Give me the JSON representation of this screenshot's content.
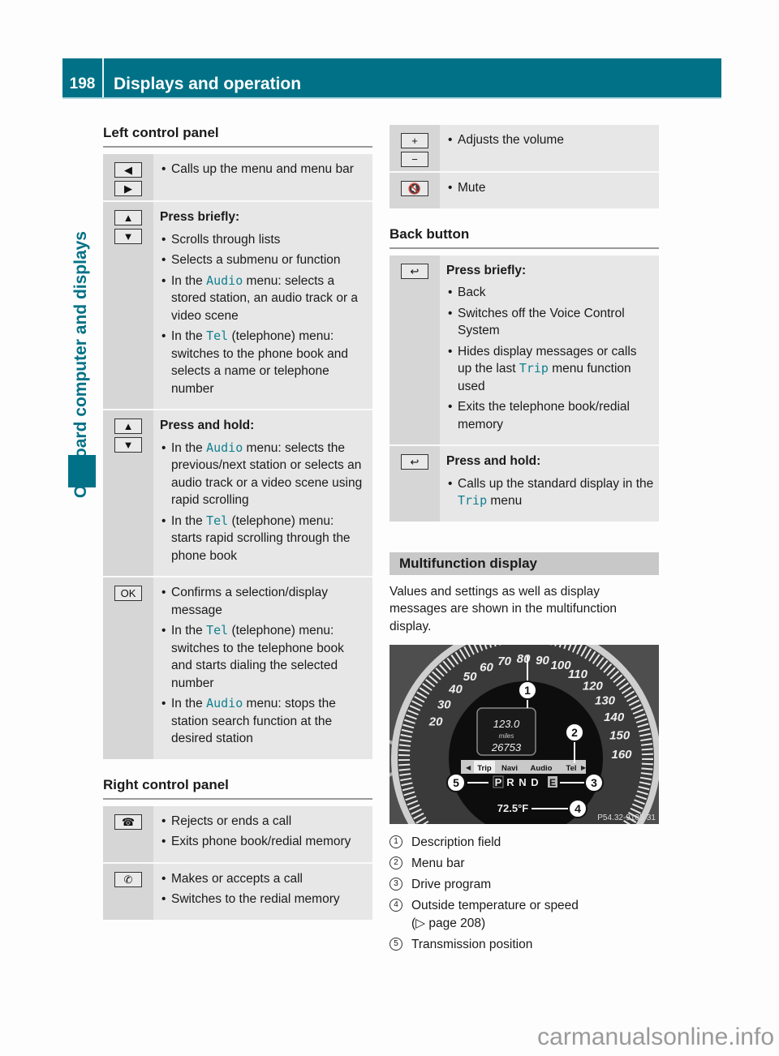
{
  "header": {
    "page_number": "198",
    "title": "Displays and operation"
  },
  "side_tab": {
    "label": "On-board computer and displays"
  },
  "left_column": {
    "left_panel": {
      "title": "Left control panel",
      "rows": [
        {
          "keys": [
            "◀",
            "▶"
          ],
          "key_names": [
            "left-arrow-icon",
            "right-arrow-icon"
          ],
          "heading": "",
          "bullets": [
            {
              "pre": "Calls up the menu and menu bar",
              "hl": "",
              "post": ""
            }
          ]
        },
        {
          "keys": [
            "▲",
            "▼"
          ],
          "key_names": [
            "up-arrow-icon",
            "down-arrow-icon"
          ],
          "heading": "Press briefly:",
          "bullets": [
            {
              "pre": "Scrolls through lists",
              "hl": "",
              "post": ""
            },
            {
              "pre": "Selects a submenu or function",
              "hl": "",
              "post": ""
            },
            {
              "pre": "In the ",
              "hl": "Audio",
              "post": " menu: selects a stored station, an audio track or a video scene"
            },
            {
              "pre": "In the ",
              "hl": "Tel",
              "post": " (telephone) menu: switches to the phone book and selects a name or telephone number"
            }
          ]
        },
        {
          "keys": [
            "▲",
            "▼"
          ],
          "key_names": [
            "up-arrow-icon",
            "down-arrow-icon"
          ],
          "heading": "Press and hold:",
          "bullets": [
            {
              "pre": "In the ",
              "hl": "Audio",
              "post": " menu: selects the previous/next station or selects an audio track or a video scene using rapid scrolling"
            },
            {
              "pre": "In the ",
              "hl": "Tel",
              "post": " (telephone) menu: starts rapid scrolling through the phone book"
            }
          ]
        },
        {
          "keys": [
            "OK"
          ],
          "key_names": [
            "ok-button-icon"
          ],
          "heading": "",
          "bullets": [
            {
              "pre": "Confirms a selection/display message",
              "hl": "",
              "post": ""
            },
            {
              "pre": "In the ",
              "hl": "Tel",
              "post": " (telephone) menu: switches to the telephone book and starts dialing the selected number"
            },
            {
              "pre": "In the ",
              "hl": "Audio",
              "post": " menu: stops the station search function at the desired station"
            }
          ]
        }
      ]
    },
    "right_panel": {
      "title": "Right control panel",
      "rows": [
        {
          "keys": [
            "☎"
          ],
          "key_names": [
            "end-call-icon"
          ],
          "heading": "",
          "bullets": [
            {
              "pre": "Rejects or ends a call",
              "hl": "",
              "post": ""
            },
            {
              "pre": "Exits phone book/redial memory",
              "hl": "",
              "post": ""
            }
          ]
        },
        {
          "keys": [
            "✆"
          ],
          "key_names": [
            "accept-call-icon"
          ],
          "heading": "",
          "bullets": [
            {
              "pre": "Makes or accepts a call",
              "hl": "",
              "post": ""
            },
            {
              "pre": "Switches to the redial memory",
              "hl": "",
              "post": ""
            }
          ]
        }
      ]
    }
  },
  "right_column": {
    "volume_rows": [
      {
        "keys": [
          "+",
          "−"
        ],
        "key_names": [
          "volume-up-icon",
          "volume-down-icon"
        ],
        "heading": "",
        "bullets": [
          {
            "pre": "Adjusts the volume",
            "hl": "",
            "post": ""
          }
        ]
      },
      {
        "keys": [
          "🔇"
        ],
        "key_names": [
          "mute-icon"
        ],
        "heading": "",
        "bullets": [
          {
            "pre": "Mute",
            "hl": "",
            "post": ""
          }
        ]
      }
    ],
    "back_button": {
      "title": "Back button",
      "rows": [
        {
          "keys": [
            "↩"
          ],
          "key_names": [
            "back-icon"
          ],
          "heading": "Press briefly:",
          "bullets": [
            {
              "pre": "Back",
              "hl": "",
              "post": ""
            },
            {
              "pre": "Switches off the Voice Control System",
              "hl": "",
              "post": ""
            },
            {
              "pre": "Hides display messages or calls up the last ",
              "hl": "Trip",
              "post": " menu function used"
            },
            {
              "pre": "Exits the telephone book/redial memory",
              "hl": "",
              "post": ""
            }
          ]
        },
        {
          "keys": [
            "↩"
          ],
          "key_names": [
            "back-icon"
          ],
          "heading": "Press and hold:",
          "bullets": [
            {
              "pre": "Calls up the standard display in the ",
              "hl": "Trip",
              "post": " menu"
            }
          ]
        }
      ]
    },
    "multifunction": {
      "title": "Multifunction display",
      "intro": "Values and settings as well as display messages are shown in the multifunction display.",
      "gauge": {
        "speed_labels": [
          "20",
          "30",
          "40",
          "50",
          "60",
          "70",
          "80",
          "90",
          "100",
          "110",
          "120",
          "130",
          "140",
          "150",
          "160"
        ],
        "trip_value": "123.0",
        "trip_unit": "miles",
        "odometer": "26753",
        "menu_items": [
          "Trip",
          "Navi",
          "Audio",
          "Tel"
        ],
        "active_menu": "Trip",
        "gears": [
          "P",
          "R",
          "N",
          "D"
        ],
        "active_gear": "P",
        "drive_program": "E",
        "temperature": "72.5°F",
        "callouts": [
          "1",
          "2",
          "3",
          "4",
          "5"
        ],
        "image_code": "P54.32-9105-31"
      },
      "legend": [
        {
          "num": "1",
          "text": "Description field"
        },
        {
          "num": "2",
          "text": "Menu bar"
        },
        {
          "num": "3",
          "text": "Drive program"
        },
        {
          "num": "4",
          "text": "Outside temperature or speed",
          "ref": "(▷ page 208)"
        },
        {
          "num": "5",
          "text": "Transmission position"
        }
      ]
    }
  },
  "watermark": "carmanualsonline.info"
}
